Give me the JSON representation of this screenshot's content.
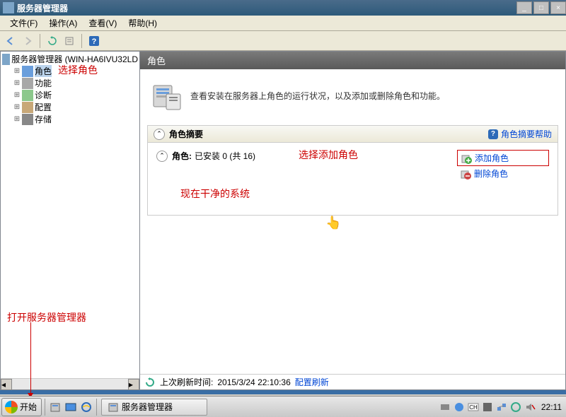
{
  "window": {
    "title": "服务器管理器",
    "menus": {
      "file": "文件(F)",
      "action": "操作(A)",
      "view": "查看(V)",
      "help": "帮助(H)"
    }
  },
  "tree": {
    "root": "服务器管理器 (WIN-HA6IVU32LD",
    "items": [
      {
        "label": "角色"
      },
      {
        "label": "功能"
      },
      {
        "label": "诊断"
      },
      {
        "label": "配置"
      },
      {
        "label": "存储"
      }
    ]
  },
  "content": {
    "heading": "角色",
    "description": "查看安装在服务器上角色的运行状况，以及添加或删除角色和功能。",
    "summary": {
      "title": "角色摘要",
      "help": "角色摘要帮助",
      "roles_label": "角色:",
      "roles_value": "已安装 0 (共 16)",
      "add": "添加角色",
      "remove": "删除角色"
    },
    "status": {
      "prefix": "上次刷新时间:",
      "time": "2015/3/24 22:10:36",
      "config": "配置刷新"
    }
  },
  "annotations": {
    "select_role": "选择角色",
    "select_add": "选择添加角色",
    "open_mgr": "打开服务器管理器",
    "clean_system": "现在干净的系统"
  },
  "taskbar": {
    "start": "开始",
    "task": "服务器管理器",
    "clock": "22:11"
  }
}
